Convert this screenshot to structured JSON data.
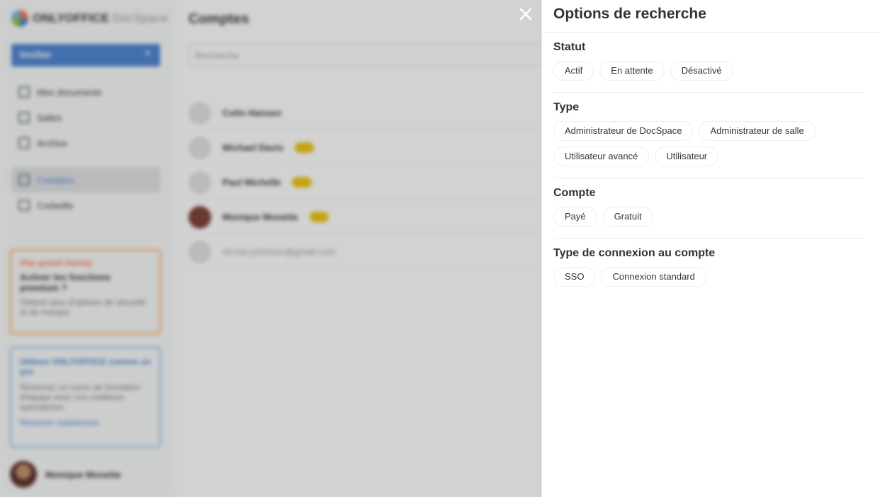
{
  "background": {
    "logo": {
      "brand": "ONLYOFFICE",
      "product": "DocSpace"
    },
    "invite_label": "Inviter",
    "nav": [
      {
        "label": "Mes documents"
      },
      {
        "label": "Salles"
      },
      {
        "label": "Archive"
      },
      {
        "label": "Comptes"
      },
      {
        "label": "Corbeille"
      }
    ],
    "main_title": "Comptes",
    "search_placeholder": "Recherche",
    "rows": [
      {
        "name": "Colin Hansen"
      },
      {
        "name": "Michael Davis"
      },
      {
        "name": "Paul Michelle"
      },
      {
        "name": "Monique Monette"
      },
      {
        "name": "eli.rian.johnson@gmail.com"
      }
    ],
    "promo": {
      "tag": "Plan gratuit Startup",
      "title": "Activer les fonctions premium ?",
      "text": "Obtenir plus d'options de sécurité et de marque"
    },
    "promo2": {
      "title": "Utilisez ONLYOFFICE comme un pro",
      "text": "Réservez un cours de formation d'équipe avec nos meilleurs spécialistes",
      "link": "Réserver maintenant"
    },
    "user_name": "Monique Monette"
  },
  "panel": {
    "title": "Options de recherche",
    "sections": [
      {
        "title": "Statut",
        "options": [
          "Actif",
          "En attente",
          "Désactivé"
        ]
      },
      {
        "title": "Type",
        "options": [
          "Administrateur de DocSpace",
          "Administrateur de salle",
          "Utilisateur avancé",
          "Utilisateur"
        ]
      },
      {
        "title": "Compte",
        "options": [
          "Payé",
          "Gratuit"
        ]
      },
      {
        "title": "Type de connexion au compte",
        "options": [
          "SSO",
          "Connexion standard"
        ]
      }
    ]
  },
  "icons": {
    "close": "close-icon"
  },
  "colors": {
    "accent": "#4781d1",
    "overlay": "#333333"
  }
}
